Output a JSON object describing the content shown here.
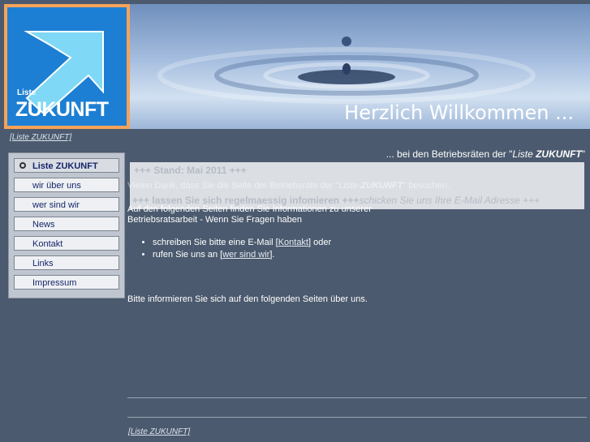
{
  "logo": {
    "small": "Liste",
    "big": "ZUKUNFT"
  },
  "banner": {
    "title": "Herzlich Willkommen ..."
  },
  "breadcrumb": "[Liste ZUKUNFT]",
  "nav": {
    "items": [
      {
        "label": "Liste ZUKUNFT"
      },
      {
        "label": "wir über uns"
      },
      {
        "label": "wer sind wir"
      },
      {
        "label": "News"
      },
      {
        "label": "Kontakt"
      },
      {
        "label": "Links"
      },
      {
        "label": "Impressum"
      }
    ]
  },
  "welcome": {
    "prefix": "... bei den Betriebsräten der \"",
    "name": "Liste ",
    "name_bold": "ZUKUNFT",
    "suffix": "\""
  },
  "news": {
    "line1": "+++ Stand: Mai 2011 +++",
    "line2_bold": "+++ lassen Sie sich regelmaessig infomieren +++",
    "line2_italic": "schicken Sie uns Ihre E-Mail Adresse +++"
  },
  "intro": {
    "thanks_pre": "Vielen Dank, dass Sie die Seite der Betriebsräte der \"",
    "thanks_name": "Liste-",
    "thanks_name_bold": "ZUKUNFT",
    "thanks_post": "\" besuchen.",
    "text": "Auf den folgenden Seiten finden Sie Informationen zu unserer Betriebsratsarbeit - Wenn Sie Fragen haben"
  },
  "list": {
    "item1_pre": "schreiben Sie bitte eine E-Mail [",
    "item1_link": "Kontakt",
    "item1_post": "] oder",
    "item2_pre": "rufen Sie uns an [",
    "item2_link": "wer sind wir",
    "item2_post": "]."
  },
  "bottom_text": "Bitte informieren Sie sich auf den folgenden Seiten über uns.",
  "footer": "[Liste ZUKUNFT]",
  "colors": {
    "background": "#4b5a6e",
    "logo_blue": "#1d7fd3",
    "logo_frame": "#f4a35a"
  }
}
